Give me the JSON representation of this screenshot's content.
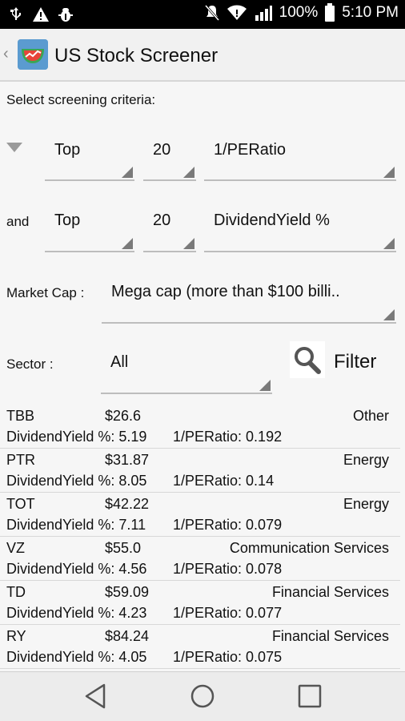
{
  "status_bar": {
    "battery": "100%",
    "time": "5:10 PM",
    "left_icons": [
      "usb-icon",
      "warning-icon",
      "bug-icon"
    ],
    "right_icons": [
      "mute-icon",
      "wifi-icon",
      "signal-icon",
      "battery-icon"
    ]
  },
  "app": {
    "title": "US Stock Screener",
    "logo_icon": "app-logo-icon"
  },
  "criteria": {
    "header": "Select screening criteria:",
    "row1": {
      "prefix_icon": "expand-triangle-icon",
      "rank": "Top",
      "count": "20",
      "metric": "1/PERatio"
    },
    "row2": {
      "prefix": "and",
      "rank": "Top",
      "count": "20",
      "metric": "DividendYield %"
    },
    "market_cap": {
      "label": "Market Cap :",
      "value": "Mega cap (more than $100 billi.."
    },
    "sector": {
      "label": "Sector :",
      "value": "All"
    },
    "filter_label": "Filter"
  },
  "results": [
    {
      "symbol": "TBB",
      "price": "$26.6",
      "sector": "Other",
      "dividend": "DividendYield %: 5.19",
      "pe": "1/PERatio: 0.192"
    },
    {
      "symbol": "PTR",
      "price": "$31.87",
      "sector": "Energy",
      "dividend": "DividendYield %: 8.05",
      "pe": "1/PERatio: 0.14"
    },
    {
      "symbol": "TOT",
      "price": "$42.22",
      "sector": "Energy",
      "dividend": "DividendYield %: 7.11",
      "pe": "1/PERatio: 0.079"
    },
    {
      "symbol": "VZ",
      "price": "$55.0",
      "sector": "Communication Services",
      "dividend": "DividendYield %: 4.56",
      "pe": "1/PERatio: 0.078"
    },
    {
      "symbol": "TD",
      "price": "$59.09",
      "sector": "Financial Services",
      "dividend": "DividendYield %: 4.23",
      "pe": "1/PERatio: 0.077"
    },
    {
      "symbol": "RY",
      "price": "$84.24",
      "sector": "Financial Services",
      "dividend": "DividendYield %: 4.05",
      "pe": "1/PERatio: 0.075"
    }
  ],
  "colors": {
    "status_bar_bg": "#000000",
    "action_bar_bg": "#f1f1f1",
    "page_bg": "#f6f6f6",
    "nav_bar_bg": "#ececec"
  }
}
